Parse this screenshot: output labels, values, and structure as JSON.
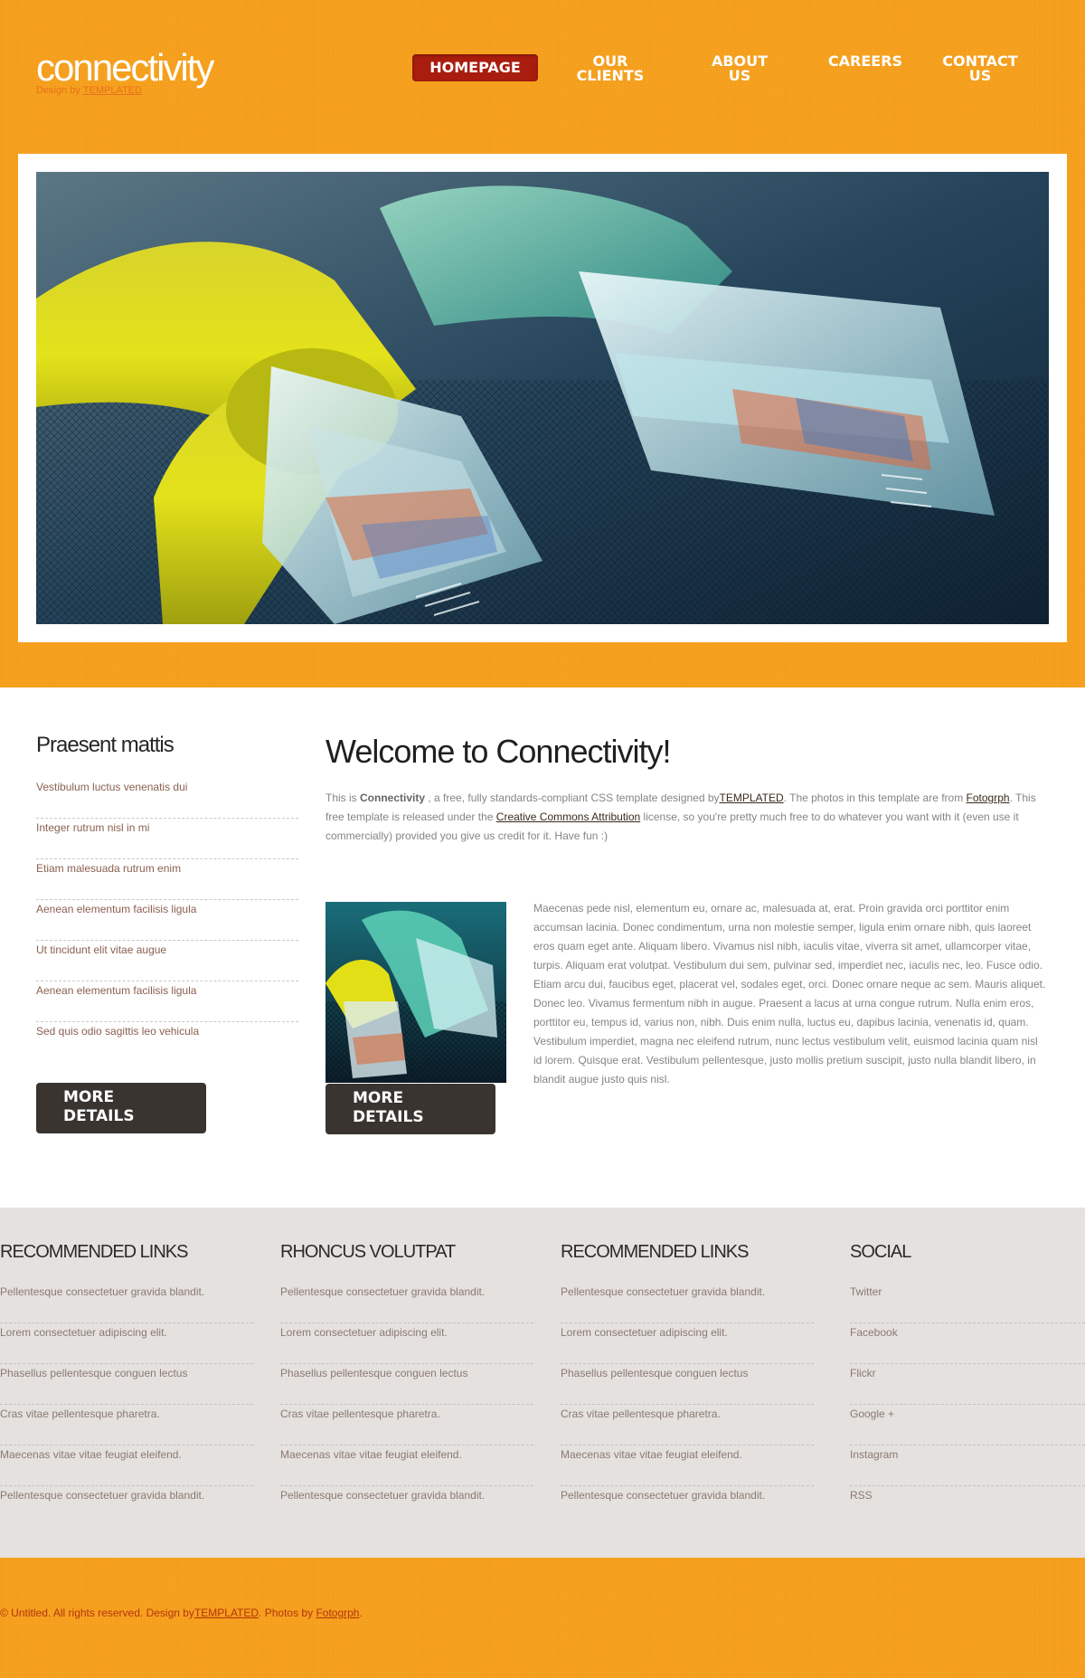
{
  "brand": {
    "name": "connectivity",
    "subtitle_prefix": "Design by ",
    "subtitle_link": "TEMPLATED"
  },
  "nav": [
    {
      "line1": "Homepage",
      "line2": "",
      "active": true
    },
    {
      "line1": "Our",
      "line2": "Clients",
      "active": false
    },
    {
      "line1": "About",
      "line2": "Us",
      "active": false
    },
    {
      "line1": "Careers",
      "line2": "",
      "active": false
    },
    {
      "line1": "Contact",
      "line2": "Us",
      "active": false
    }
  ],
  "sidebar": {
    "heading": "Praesent mattis",
    "items": [
      "Vestibulum luctus venenatis dui",
      "Integer rutrum nisl in mi",
      "Etiam malesuada rutrum enim",
      "Aenean elementum facilisis ligula",
      "Ut tincidunt elit vitae augue",
      "Aenean elementum facilisis ligula",
      "Sed quis odio sagittis leo vehicula"
    ],
    "button": {
      "line1": "More",
      "line2": "Details"
    }
  },
  "content": {
    "heading": "Welcome to Connectivity!",
    "intro": {
      "p1": "This is ",
      "strong": "Connectivity",
      "p2": " , a free, fully standards-compliant CSS template designed by",
      "link1": "TEMPLATED",
      "p3": ". The photos in this template are from ",
      "link2": "Fotogrph",
      "p4": ". This free template is released under the ",
      "link3": "Creative Commons Attribution",
      "p5": " license, so you're pretty much free to do whatever you want with it (even use it commercially) provided you give us credit for it. Have fun :)"
    },
    "body": "Maecenas pede nisl, elementum eu, ornare ac, malesuada at, erat. Proin gravida orci porttitor enim accumsan lacinia. Donec condimentum, urna non molestie semper, ligula enim ornare nibh, quis laoreet eros quam eget ante. Aliquam libero. Vivamus nisl nibh, iaculis vitae, viverra sit amet, ullamcorper vitae, turpis. Aliquam erat volutpat. Vestibulum dui sem, pulvinar sed, imperdiet nec, iaculis nec, leo. Fusce odio. Etiam arcu dui, faucibus eget, placerat vel, sodales eget, orci. Donec ornare neque ac sem. Mauris aliquet. Donec leo. Vivamus fermentum nibh in augue. Praesent a lacus at urna congue rutrum. Nulla enim eros, porttitor eu, tempus id, varius non, nibh. Duis enim nulla, luctus eu, dapibus lacinia, venenatis id, quam. Vestibulum imperdiet, magna nec eleifend rutrum, nunc lectus vestibulum velit, euismod lacinia quam nisl id lorem. Quisque erat. Vestibulum pellentesque, justo mollis pretium suscipit, justo nulla blandit libero, in blandit augue justo quis nisl.",
    "button": {
      "line1": "More",
      "line2": "Details"
    }
  },
  "columns": [
    {
      "heading": "Recommended Links",
      "items": [
        "Pellentesque consectetuer gravida blandit.",
        "Lorem consectetuer adipiscing elit.",
        "Phasellus pellentesque conguen lectus",
        "Cras vitae pellentesque pharetra.",
        "Maecenas vitae vitae feugiat eleifend.",
        "Pellentesque consectetuer gravida blandit."
      ]
    },
    {
      "heading": "Rhoncus Volutpat",
      "items": [
        "Pellentesque consectetuer gravida blandit.",
        "Lorem consectetuer adipiscing elit.",
        "Phasellus pellentesque conguen lectus",
        "Cras vitae pellentesque pharetra.",
        "Maecenas vitae vitae feugiat eleifend.",
        "Pellentesque consectetuer gravida blandit."
      ]
    },
    {
      "heading": "Recommended Links",
      "items": [
        "Pellentesque consectetuer gravida blandit.",
        "Lorem consectetuer adipiscing elit.",
        "Phasellus pellentesque conguen lectus",
        "Cras vitae pellentesque pharetra.",
        "Maecenas vitae vitae feugiat eleifend.",
        "Pellentesque consectetuer gravida blandit."
      ]
    },
    {
      "heading": "Social",
      "items": [
        "Twitter",
        "Facebook",
        "Flickr",
        "Google +",
        "Instagram",
        "RSS"
      ]
    }
  ],
  "footer": {
    "p1": "© Untitled. All rights reserved. Design by",
    "link1": "TEMPLATED",
    "p2": ". Photos by ",
    "link2": "Fotogrph",
    "p3": "."
  },
  "colors": {
    "orange": "#f7a01c",
    "nav_active": "#a81d0e",
    "button_dark": "#3a3430",
    "link_section_bg": "#e5e1de"
  }
}
